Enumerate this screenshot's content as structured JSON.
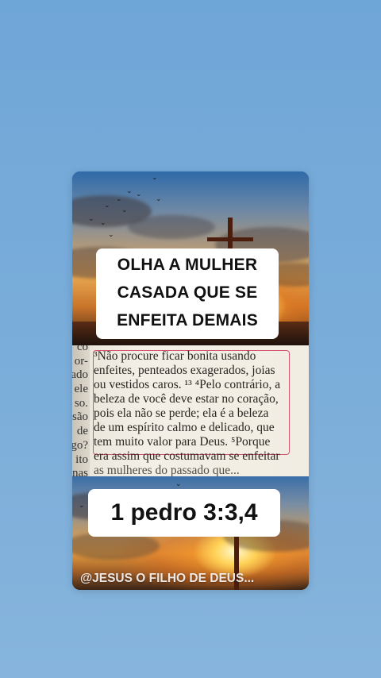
{
  "caption": {
    "lines": [
      "OLHA A MULHER",
      "CASADA QUE SE",
      "ENFEITA DEMAIS"
    ]
  },
  "bible_page": {
    "margin_fragments": [
      "co",
      "or-",
      "ado",
      "ele",
      "so.",
      "são",
      "de",
      "go?",
      "ito",
      "nas"
    ],
    "lines": [
      "³Não procure ficar bonita usando",
      "enfeites, penteados exagerados, joias",
      "ou vestidos caros. ¹³ ⁴Pelo contrário, a",
      "beleza de você deve estar no coração,",
      "pois ela não se perde; ela é a beleza",
      "de um espírito calmo e delicado, que",
      "tem muito valor para Deus. ⁵Porque",
      "era assim que costumavam se enfeitar",
      "as mulheres do passado que..."
    ]
  },
  "reference": "1 pedro 3:3,4",
  "watermark": "@JESUS O FILHO DE DEUS...",
  "colors": {
    "background": "#79acd9",
    "highlight_box": "#d0576e",
    "cross": "#4a1d0c"
  }
}
